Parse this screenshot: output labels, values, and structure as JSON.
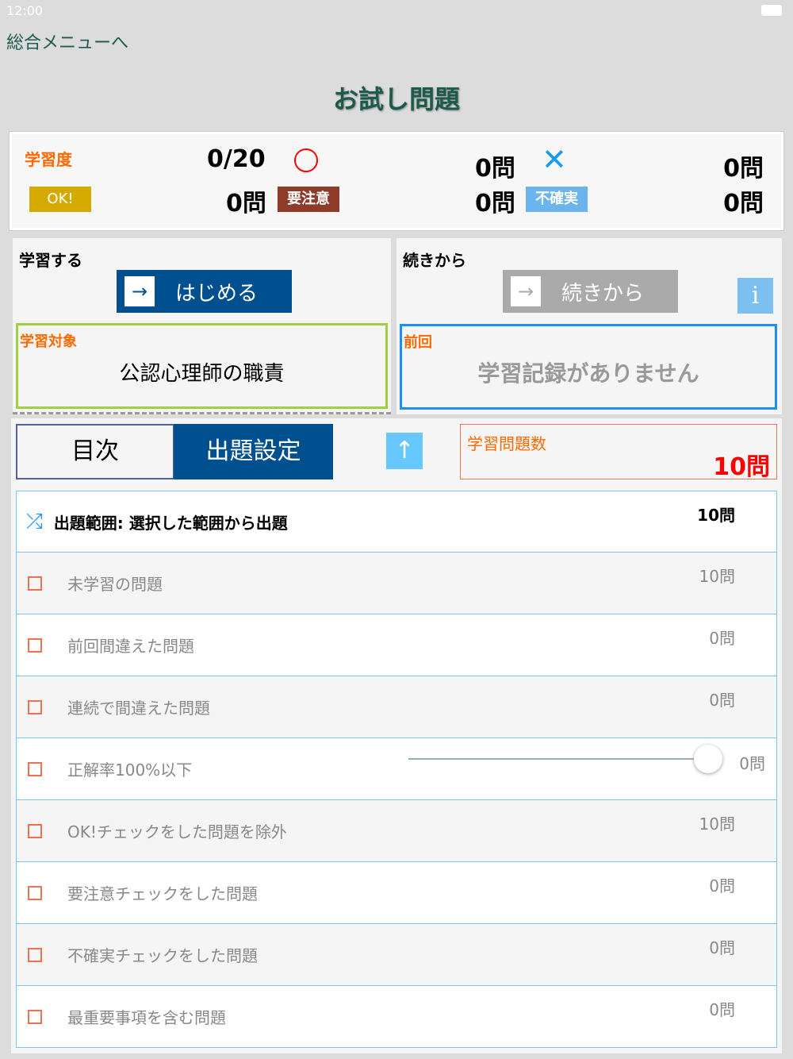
{
  "status_bar": {
    "time": "12:00"
  },
  "nav": {
    "back": "総合メニューへ",
    "title": "お試し問題"
  },
  "summary": {
    "label": "学習度",
    "progress": "0/20",
    "correct": "0問",
    "wrong": "0問",
    "last": "0問",
    "ok_label": "OK!",
    "ok_count": "0問",
    "caution_label": "要注意",
    "caution_count": "0問",
    "uncertain_label": "不確実",
    "uncertain_count": "0問"
  },
  "study": {
    "heading": "学習する",
    "start_button": "はじめる",
    "target_label": "学習対象",
    "target_value": "公認心理師の職責"
  },
  "resume": {
    "heading": "続きから",
    "resume_button": "続きから",
    "info": "i",
    "prev_label": "前回",
    "prev_value": "学習記録がありません"
  },
  "tabs": [
    {
      "label": "目次"
    },
    {
      "label": "出題設定"
    }
  ],
  "question_count": {
    "label": "学習問題数",
    "value": "10問"
  },
  "range": {
    "label": "出題範囲: 選択した範囲から出題",
    "count": "10問"
  },
  "filters": [
    {
      "label": "未学習の問題",
      "count": "10問"
    },
    {
      "label": "前回間違えた問題",
      "count": "0問"
    },
    {
      "label": "連続で間違えた問題",
      "count": "0問"
    },
    {
      "label": "正解率100%以下",
      "count": "0問",
      "slider": 1.0
    },
    {
      "label": "OK!チェックをした問題を除外",
      "count": "10問"
    },
    {
      "label": "要注意チェックをした問題",
      "count": "0問"
    },
    {
      "label": "不確実チェックをした問題",
      "count": "0問"
    },
    {
      "label": "最重要事項を含む問題",
      "count": "0問"
    }
  ],
  "colors": {
    "accent": "#00508f",
    "orange": "#ff6a00",
    "ok": "#d4aa00",
    "caution": "#8e3b2a",
    "uncertain": "#6cb4ee"
  }
}
